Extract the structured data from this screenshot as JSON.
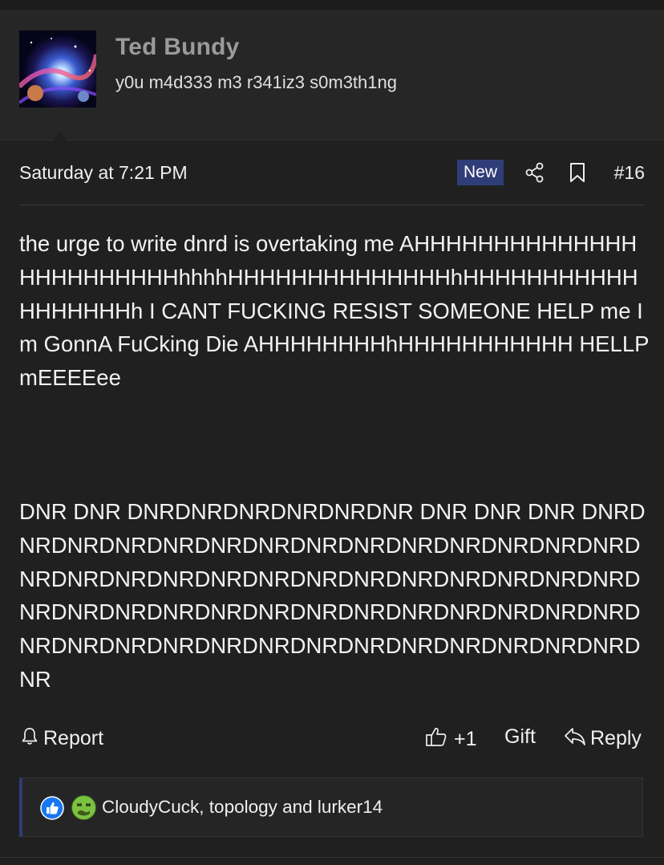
{
  "author": {
    "name": "Ted Bundy",
    "title": "y0u m4d333 m3 r341iz3 s0m3th1ng"
  },
  "post": {
    "date": "Saturday at 7:21 PM",
    "badge": "New",
    "number": "#16",
    "paragraphs": [
      "the urge to write dnrd is overtaking me AHHHHHHHHHHHHHHHHHHHHHHHHhhhhHHHHHHHHHHHHHHhHHHHHHHHHHHHHHHHHHh I CANT FUCKING RESIST SOMEONE HELP me Im GonnA FuCking Die AHHHHHHHHhHHHHHHHHHHH HELLP mEEEEee",
      "DNR DNR DNRDNRDNRDNRDNRDNR DNR DNR DNR DNRDNRDNRDNRDNRDNRDNRDNRDNRDNRDNRDNRDNRDNRDNRDNRDNRDNRDNRDNRDNRDNRDNRDNRDNRDNRDNRDNRDNRDNRDNRDNRDNRDNRDNRDNRDNRDNRDNRDNRDNRDNRDNRDNRDNRDNRDNRDNRDNRDNRDNRDNRDNRDNR"
    ]
  },
  "actions": {
    "report": "Report",
    "like": "+1",
    "gift": "Gift",
    "reply": "Reply"
  },
  "reactions": {
    "text": "CloudyCuck, topology and lurker14",
    "icons": [
      "thumbs-up-reaction",
      "sick-face-reaction"
    ]
  },
  "colors": {
    "background": "#202020",
    "author_panel": "#262626",
    "badge": "#2f3d78",
    "like_reaction": "#1877f2",
    "sick_reaction": "#7cc242"
  }
}
